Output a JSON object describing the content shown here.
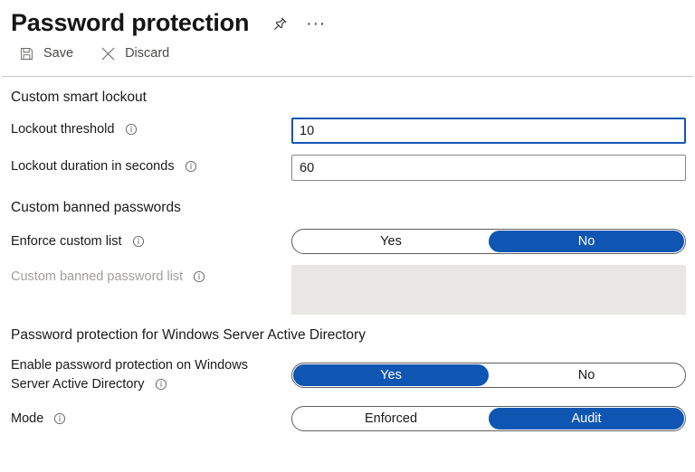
{
  "header": {
    "title": "Password protection",
    "pin_icon": "pin-icon",
    "more_icon": "ellipsis-icon",
    "more_label": "···"
  },
  "command_bar": {
    "save": {
      "label": "Save",
      "icon": "save-floppy-icon"
    },
    "discard": {
      "label": "Discard",
      "icon": "close-x-icon"
    }
  },
  "sections": {
    "smart_lockout": {
      "heading": "Custom smart lockout",
      "lockout_threshold": {
        "label": "Lockout threshold",
        "value": "10",
        "info_icon": "info-icon",
        "focused": true
      },
      "lockout_duration": {
        "label": "Lockout duration in seconds",
        "value": "60",
        "info_icon": "info-icon",
        "focused": false
      }
    },
    "banned_passwords": {
      "heading": "Custom banned passwords",
      "enforce_custom_list": {
        "label": "Enforce custom list",
        "info_icon": "info-icon",
        "options": [
          "Yes",
          "No"
        ],
        "selected": "No"
      },
      "custom_banned_password_list": {
        "label": "Custom banned password list",
        "info_icon": "info-icon",
        "value": "",
        "disabled": true
      }
    },
    "windows_server_ad": {
      "heading": "Password protection for Windows Server Active Directory",
      "enable_protection": {
        "label": "Enable password protection on Windows Server Active Directory",
        "info_icon": "info-icon",
        "options": [
          "Yes",
          "No"
        ],
        "selected": "Yes"
      },
      "mode": {
        "label": "Mode",
        "info_icon": "info-icon",
        "options": [
          "Enforced",
          "Audit"
        ],
        "selected": "Audit"
      }
    }
  },
  "colors": {
    "accent_blue": "#0f56b3",
    "focus_blue": "#0f56b3",
    "border_gray": "#8a8886",
    "disabled_bg": "#e9e7e4",
    "disabled_text": "#a19f9d"
  }
}
